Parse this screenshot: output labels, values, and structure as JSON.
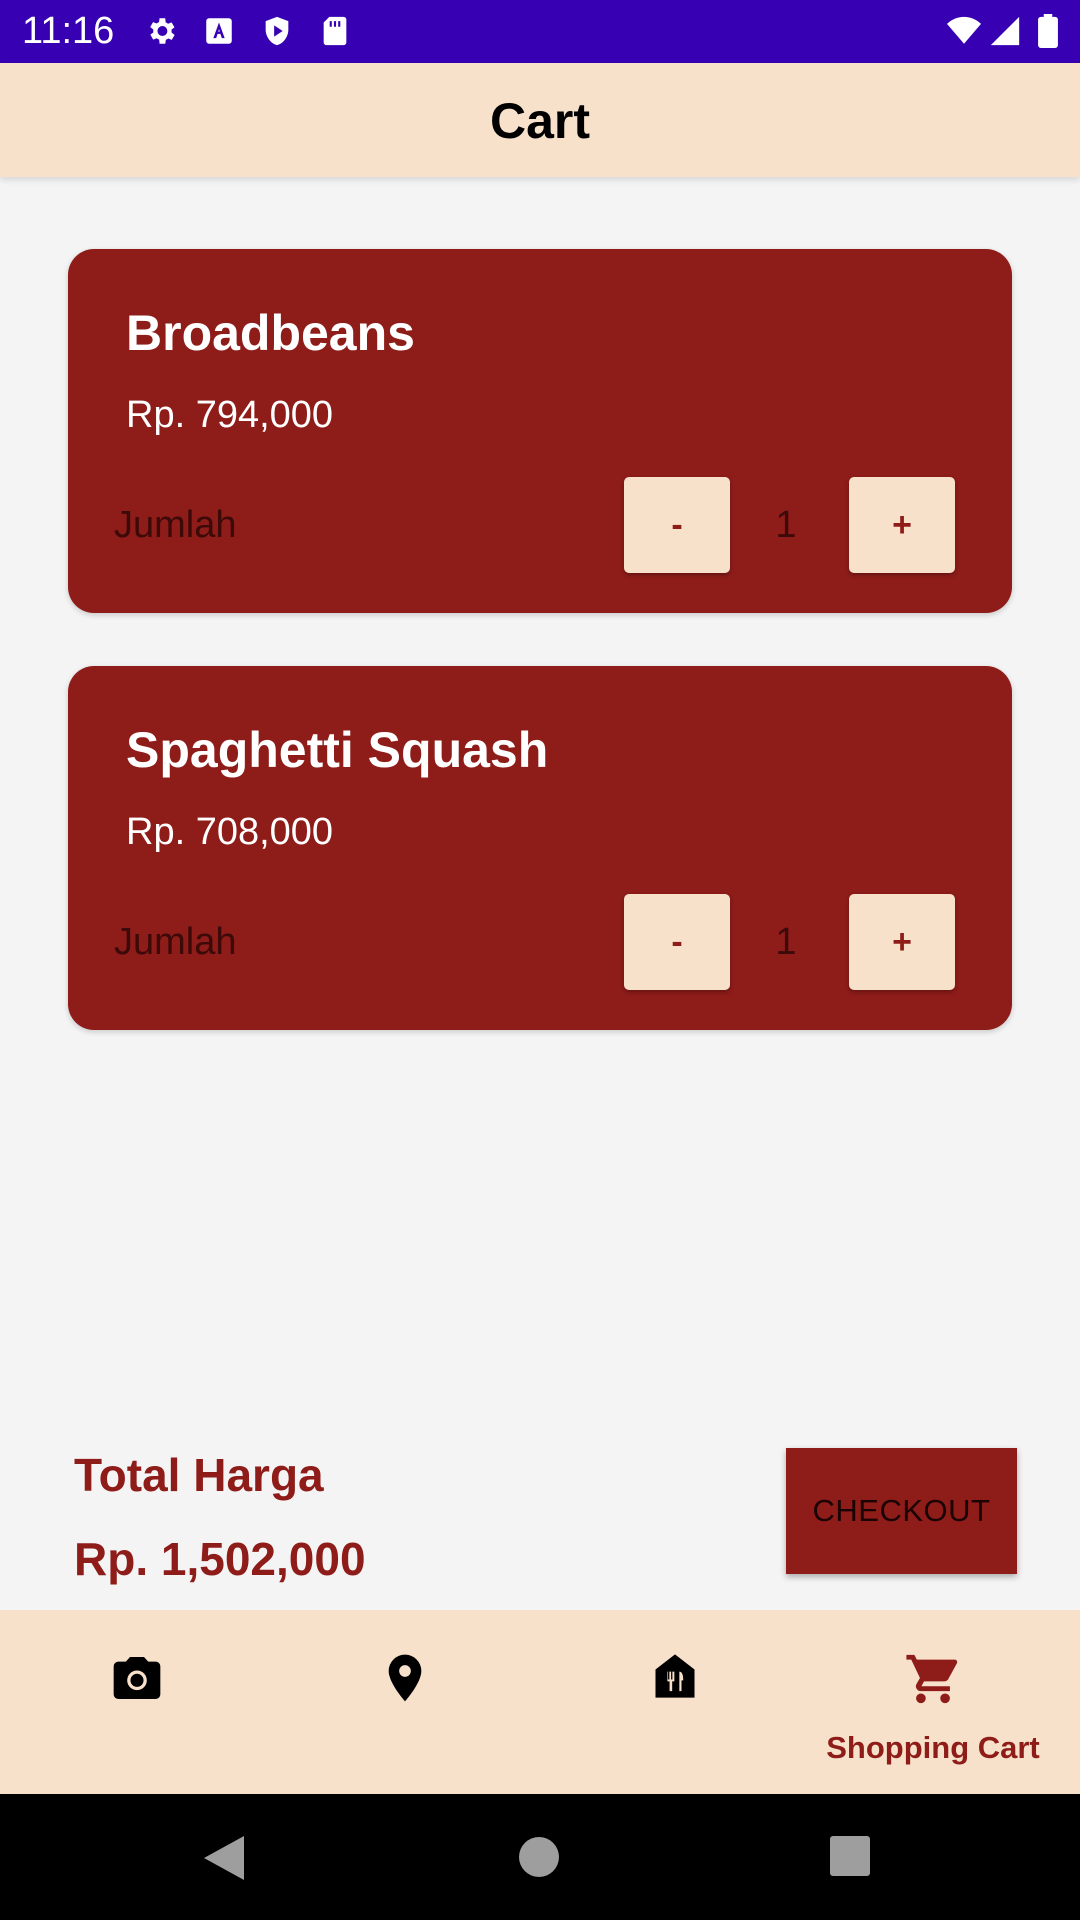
{
  "status_bar": {
    "time": "11:16",
    "icons": [
      "settings-icon",
      "a-icon",
      "shield-play-icon",
      "sd-card-icon",
      "wifi-icon",
      "signal-icon",
      "battery-icon"
    ]
  },
  "app_bar": {
    "title": "Cart"
  },
  "cart": {
    "items": [
      {
        "name": "Broadbeans",
        "price": "Rp. 794,000",
        "qty_label": "Jumlah",
        "minus": "-",
        "qty": "1",
        "plus": "+"
      },
      {
        "name": "Spaghetti Squash",
        "price": "Rp. 708,000",
        "qty_label": "Jumlah",
        "minus": "-",
        "qty": "1",
        "plus": "+"
      }
    ]
  },
  "summary": {
    "total_label": "Total Harga",
    "total_value": "Rp. 1,502,000",
    "checkout_label": "CHECKOUT"
  },
  "bottom_nav": {
    "items": [
      {
        "icon": "camera-icon",
        "label": ""
      },
      {
        "icon": "location-pin-icon",
        "label": ""
      },
      {
        "icon": "restaurant-icon",
        "label": ""
      },
      {
        "icon": "shopping-cart-icon",
        "label": "Shopping Cart",
        "active": true
      }
    ]
  },
  "colors": {
    "status_bar": "#3700b3",
    "app_bar": "#f8e1ca",
    "card": "#8e1c19",
    "accent": "#8e1c19",
    "background": "#f4f4f5"
  }
}
